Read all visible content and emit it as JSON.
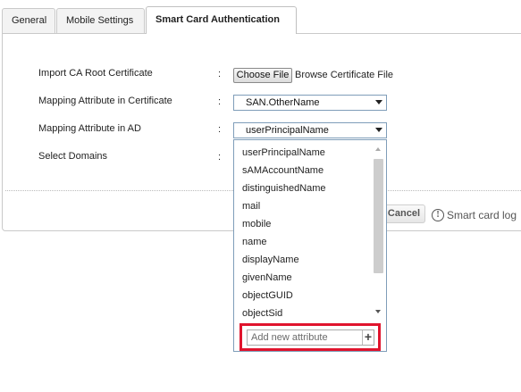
{
  "tabs": [
    {
      "label": "General"
    },
    {
      "label": "Mobile Settings"
    },
    {
      "label": "Smart Card Authentication"
    }
  ],
  "form": {
    "colon": ":",
    "import_label": "Import CA Root Certificate",
    "choose_file_label": "Choose File",
    "browse_text": "Browse Certificate File",
    "mapping_cert_label": "Mapping Attribute in Certificate",
    "mapping_cert_value": "SAN.OtherName",
    "mapping_ad_label": "Mapping Attribute in AD",
    "mapping_ad_value": "userPrincipalName",
    "select_domains_label": "Select Domains"
  },
  "dropdown": {
    "items": [
      "userPrincipalName",
      "sAMAccountName",
      "distinguishedName",
      "mail",
      "mobile",
      "name",
      "displayName",
      "givenName",
      "objectGUID",
      "objectSid"
    ],
    "add_placeholder": "Add new attribute",
    "add_button": "+"
  },
  "footer": {
    "cancel_label": "Cancel",
    "info_icon_glyph": "!",
    "info_text": "Smart card log"
  },
  "colors": {
    "highlight": "#e0142d",
    "input_border": "#7f9db9"
  }
}
